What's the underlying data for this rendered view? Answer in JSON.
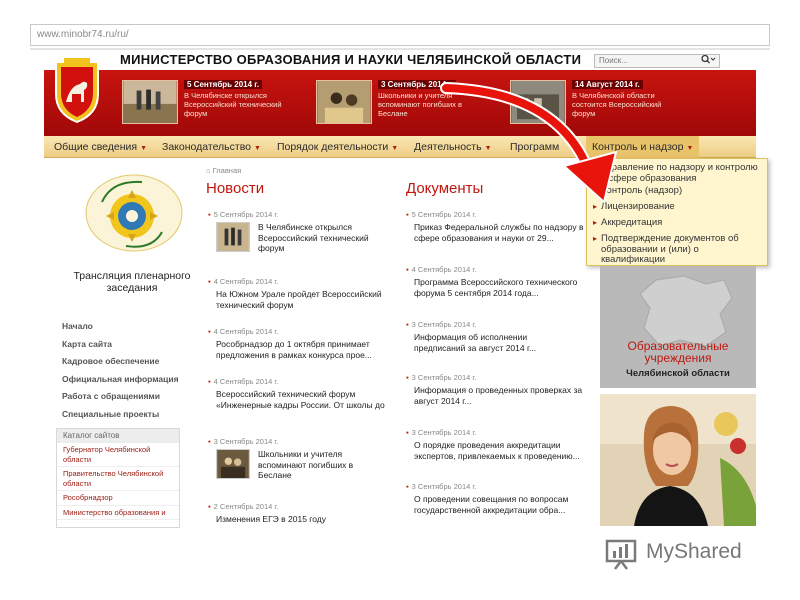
{
  "browser": {
    "url": "www.minobr74.ru/ru/"
  },
  "header": {
    "title": "МИНИСТЕРСТВО ОБРАЗОВАНИЯ И НАУКИ ЧЕЛЯБИНСКОЙ ОБЛАСТИ",
    "search_placeholder": "Поиск...",
    "banner_color": "#b50f0b",
    "banner_news": [
      {
        "date": "5 Сентябрь 2014 г.",
        "text": "В Челябинске открылся Всероссийский технический форум"
      },
      {
        "date": "3 Сентябрь 2014 г.",
        "text": "Школьники и учителя вспоминают погибших в Беслане"
      },
      {
        "date": "14 Август 2014 г.",
        "text": "В Челябинской области состоится Всероссийский форум"
      }
    ]
  },
  "nav": {
    "items": [
      {
        "label": "Общие сведения"
      },
      {
        "label": "Законодательство"
      },
      {
        "label": "Порядок деятельности"
      },
      {
        "label": "Деятельность"
      },
      {
        "label": "Программ"
      },
      {
        "label": "Контроль и надзор"
      }
    ],
    "dropdown": [
      {
        "label": "Управление по надзору и контролю в сфере образования"
      },
      {
        "label": "Контроль (надзор)"
      },
      {
        "label": "Лицензирование"
      },
      {
        "label": "Аккредитация"
      },
      {
        "label": "Подтверждение документов об образовании и (или) о квалификации"
      }
    ]
  },
  "sidebar": {
    "broadcast": "Трансляция пленарного заседания",
    "links": [
      {
        "label": "Начало"
      },
      {
        "label": "Карта сайта"
      },
      {
        "label": "Кадровое обеспечение"
      },
      {
        "label": "Официальная информация"
      },
      {
        "label": "Работа с обращениями"
      },
      {
        "label": "Специальные проекты"
      }
    ],
    "catalog": {
      "title": "Каталог сайтов",
      "items": [
        {
          "label": "Губернатор Челябинской области"
        },
        {
          "label": "Правительство Челябинской области"
        },
        {
          "label": "Рособрнадзор"
        },
        {
          "label": "Министерство образования и"
        }
      ]
    }
  },
  "breadcrumb": "Главная",
  "news": {
    "title": "Новости",
    "items": [
      {
        "date": "5 Сентябрь 2014 г.",
        "text": "В Челябинске открылся Всероссийский технический форум"
      },
      {
        "date": "4 Сентябрь 2014 г.",
        "text": "На Южном Урале пройдет Всероссийский технический форум"
      },
      {
        "date": "4 Сентябрь 2014 г.",
        "text": "Рособрнадзор до 1 октября принимает предложения в рамках конкурса прое..."
      },
      {
        "date": "4 Сентябрь 2014 г.",
        "text": "Всероссийский технический форум «Инженерные кадры России. От школы до"
      },
      {
        "date": "3 Сентябрь 2014 г.",
        "text": "Школьники и учителя вспоминают погибших в Беслане"
      },
      {
        "date": "2 Сентябрь 2014 г.",
        "text": "Изменения ЕГЭ в 2015 году"
      }
    ]
  },
  "docs": {
    "title": "Документы",
    "items": [
      {
        "date": "5 Сентябрь 2014 г.",
        "text": "Приказ Федеральной службы по надзору в сфере образования и науки от 29..."
      },
      {
        "date": "4 Сентябрь 2014 г.",
        "text": "Программа Всероссийского технического форума 5 сентября 2014 года..."
      },
      {
        "date": "3 Сентябрь 2014 г.",
        "text": "Информация об исполнении предписаний за август 2014 г..."
      },
      {
        "date": "3 Сентябрь 2014 г.",
        "text": "Информация о проведенных проверках за август 2014 г..."
      },
      {
        "date": "3 Сентябрь 2014 г.",
        "text": "О порядке проведения аккредитации экспертов, привлекаемых к проведению..."
      },
      {
        "date": "3 Сентябрь 2014 г.",
        "text": "О проведении совещания по вопросам государственной аккредитации обра..."
      }
    ]
  },
  "right": {
    "map_title": "Образовательные учреждения",
    "map_subtitle": "Челябинской области"
  },
  "watermark": {
    "text": "MyShared"
  },
  "colors": {
    "accent": "#c0170f",
    "nav": "#f3d797",
    "dropdown": "#fff6cf",
    "arrow": "#e8140c"
  }
}
